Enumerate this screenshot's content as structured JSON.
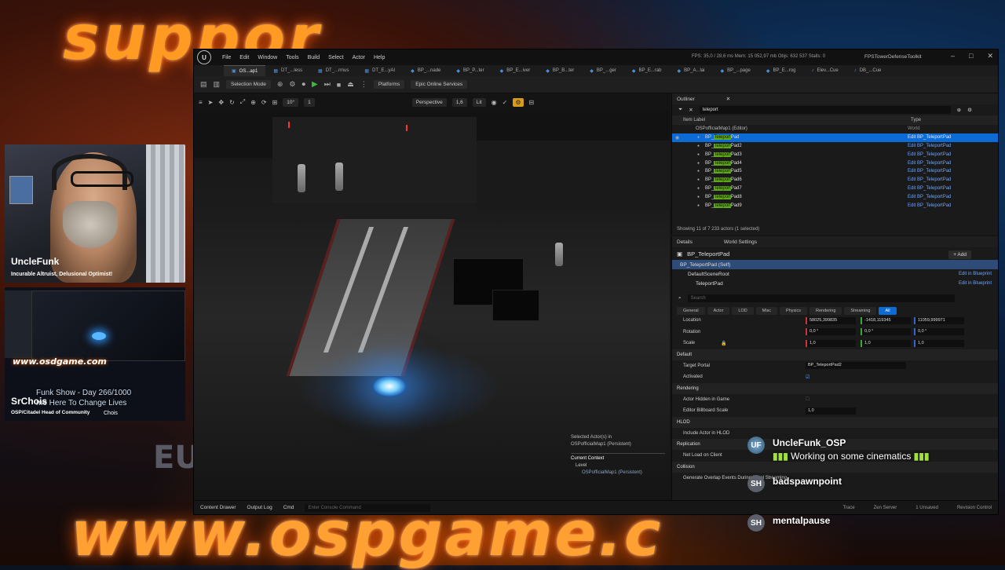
{
  "background": {
    "headline": "suppor",
    "url_banner": "www.ospgame.c",
    "side_letters": "EU"
  },
  "editor": {
    "menu": [
      "File",
      "Edit",
      "Window",
      "Tools",
      "Build",
      "Select",
      "Actor",
      "Help"
    ],
    "stats": "FPS: 35,0  /  28,6 ms  Mem: 15 052,97 mb  Objs: 632 537  Stalls: 0",
    "project": "FPSTowerDefenseToolkit",
    "active_tab": "OS...ap1",
    "tabs": [
      "DT_...less",
      "DT_...rmus",
      "DT_E...yAI",
      "BP_...nade",
      "BP_P...ter",
      "BP_E...iver",
      "BP_B...ter",
      "BP_...ger",
      "BP_E...rab",
      "BP_A...lai",
      "BP_...page",
      "BP_E...rog",
      "Elev...Cue",
      "DB_...Cue"
    ],
    "toolbar": {
      "selection_mode": "Selection Mode",
      "platforms": "Platforms",
      "epic_services": "Epic Online Services"
    },
    "viewport": {
      "perspective": "Perspective",
      "lit": "Lit",
      "snap_value": "10°",
      "scale_value": "1",
      "speed": "1,6",
      "selected_label": "Selected Actor(s) in",
      "selected_map": "OSPofficialMap1 (Persistent)",
      "current_context": "Current Context",
      "level_label": "Level",
      "level_value": "OSPofficialMap1 (Persistent)"
    },
    "outliner": {
      "tab": "Outliner",
      "search": "teleport",
      "col_label": "Item Label",
      "col_type": "Type",
      "world_row": "OSPofficialMap1 (Editor)",
      "world_type": "World",
      "rows": [
        {
          "pre": "BP_",
          "hl": "Teleport",
          "post": "Pad",
          "type": "Edit BP_TeleportPad",
          "sel": true
        },
        {
          "pre": "BP_",
          "hl": "Teleport",
          "post": "Pad2",
          "type": "Edit BP_TeleportPad",
          "sel": false
        },
        {
          "pre": "BP_",
          "hl": "Teleport",
          "post": "Pad3",
          "type": "Edit BP_TeleportPad",
          "sel": false
        },
        {
          "pre": "BP_",
          "hl": "Teleport",
          "post": "Pad4",
          "type": "Edit BP_TeleportPad",
          "sel": false
        },
        {
          "pre": "BP_",
          "hl": "Teleport",
          "post": "Pad5",
          "type": "Edit BP_TeleportPad",
          "sel": false
        },
        {
          "pre": "BP_",
          "hl": "Teleport",
          "post": "Pad6",
          "type": "Edit BP_TeleportPad",
          "sel": false
        },
        {
          "pre": "BP_",
          "hl": "Teleport",
          "post": "Pad7",
          "type": "Edit BP_TeleportPad",
          "sel": false
        },
        {
          "pre": "BP_",
          "hl": "Teleport",
          "post": "Pad8",
          "type": "Edit BP_TeleportPad",
          "sel": false
        },
        {
          "pre": "BP_",
          "hl": "Teleport",
          "post": "Pad9",
          "type": "Edit BP_TeleportPad",
          "sel": false
        }
      ],
      "footer": "Showing 11 of 7 233 actors (1 selected)"
    },
    "details": {
      "tab": "Details",
      "tab2": "World Settings",
      "actor": "BP_TeleportPad",
      "add": "+ Add",
      "components": [
        {
          "name": "BP_TeleportPad (Self)",
          "edit": ""
        },
        {
          "name": "DefaultSceneRoot",
          "edit": "Edit in Blueprint"
        },
        {
          "name": "TeleportPad",
          "edit": "Edit in Blueprint"
        }
      ],
      "search_placeholder": "Search",
      "filters": [
        "General",
        "Actor",
        "LOD",
        "Misc",
        "Physics",
        "Rendering",
        "Streaming",
        "All"
      ],
      "transform": {
        "location_label": "Location",
        "location": [
          "58025,399835",
          "-1418,119345",
          "11059,999971"
        ],
        "rotation_label": "Rotation",
        "rotation": [
          "0,0 °",
          "0,0 °",
          "0,0 °"
        ],
        "scale_label": "Scale",
        "scale": [
          "1,0",
          "1,0",
          "1,0"
        ]
      },
      "sec_default": "Default",
      "target_portal_label": "Target Portal",
      "target_portal": "BP_TeleportPad2",
      "activated_label": "Activated",
      "sec_rendering": "Rendering",
      "hidden_label": "Actor Hidden in Game",
      "billboard_label": "Editor Billboard Scale",
      "billboard_value": "1,0",
      "sec_hlod": "HLOD",
      "hlod_label": "Include Actor in HLOD",
      "sec_replication": "Replication",
      "netload_label": "Net Load on Client",
      "sec_collision": "Collision",
      "overlap_label": "Generate Overlap Events During Level Streaming"
    },
    "bottom": {
      "content_drawer": "Content Drawer",
      "output_log": "Output Log",
      "cmd": "Cmd",
      "console_placeholder": "Enter Console Command",
      "trace": "Trace",
      "derived": "Zen Server",
      "unsaved": "1 Unsaved",
      "revision": "Revision Control"
    }
  },
  "stream": {
    "streamer_name": "UncleFunk",
    "streamer_tag": "Incurable Altruist, Delusional Optimist!",
    "mini_url": "www.osdgame.com",
    "ticker_line1": "Funk Show - Day 266/1000",
    "ticker_line2": "me Here To Change Lives",
    "cohost_name": "SrChois",
    "cohost_tag": "OSP/Citadel Head of Community",
    "cohost_small": "Chois"
  },
  "chat": [
    {
      "avatar": "UF",
      "name": "UncleFunk_OSP",
      "text": "Working on some cinematics"
    },
    {
      "avatar": "SH",
      "name": "badspawnpoint",
      "text": ""
    },
    {
      "avatar": "SH",
      "name": "mentalpause",
      "text": ""
    }
  ],
  "colors": {
    "accent_blue": "#0d6bd6",
    "highlight_green": "#5fa817",
    "link_blue": "#6ba5ff",
    "play_green": "#3fb83f",
    "neon_orange": "#ff9a22"
  }
}
